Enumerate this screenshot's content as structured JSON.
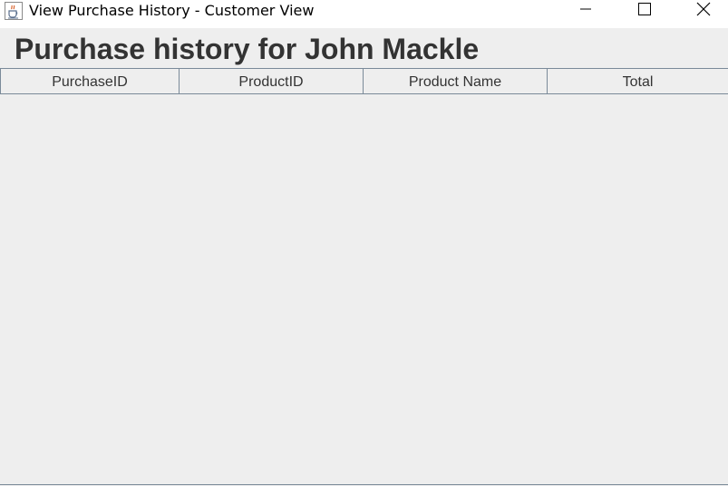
{
  "window": {
    "title": "View Purchase History - Customer View",
    "icon": "java-cup-icon"
  },
  "controls": {
    "minimize_icon": "minimize-icon",
    "maximize_icon": "maximize-icon",
    "close_icon": "close-icon"
  },
  "main": {
    "heading": "Purchase history for John Mackle"
  },
  "table": {
    "columns": [
      "PurchaseID",
      "ProductID",
      "Product Name",
      "Total"
    ],
    "rows": []
  },
  "colors": {
    "background": "#eeeeee",
    "border": "#7a8a99",
    "heading_text": "#333333"
  }
}
